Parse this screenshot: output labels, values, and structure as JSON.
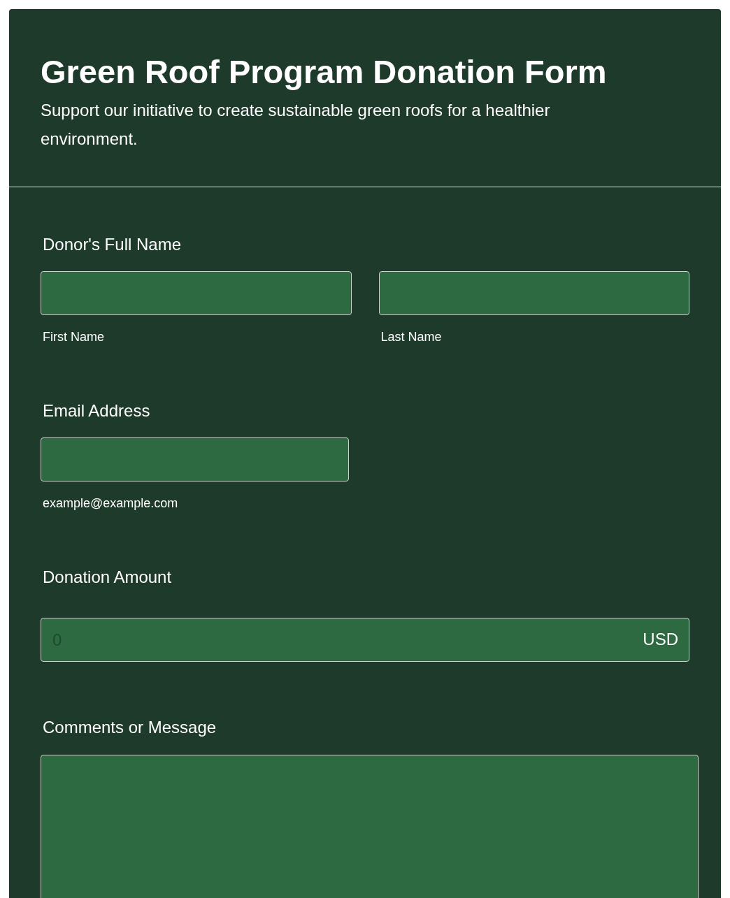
{
  "header": {
    "title": "Green Roof Program Donation Form",
    "subtitle": "Support our initiative to create sustainable green roofs for a healthier environment."
  },
  "fields": [
    {
      "kind": "name",
      "label": "Donor's Full Name",
      "parts": [
        {
          "sublabel": "First Name"
        },
        {
          "sublabel": "Last Name"
        }
      ]
    },
    {
      "kind": "email",
      "label": "Email Address",
      "sublabel": "example@example.com"
    },
    {
      "kind": "amount",
      "label": "Donation Amount",
      "placeholder": "0",
      "currency": "USD"
    },
    {
      "kind": "textarea",
      "label": "Comments or Message"
    }
  ]
}
